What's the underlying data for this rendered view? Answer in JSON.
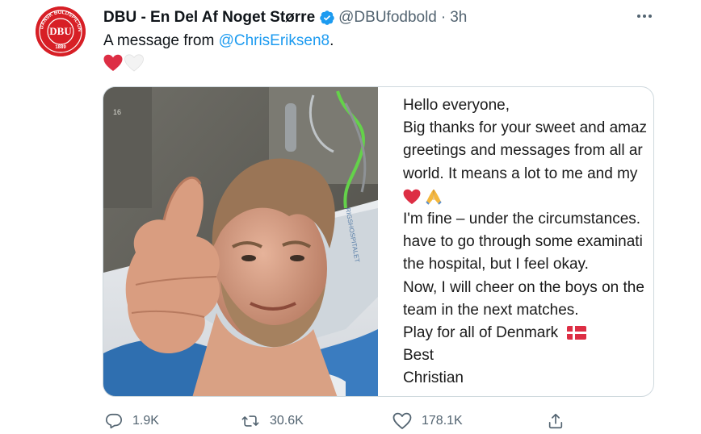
{
  "tweet": {
    "display_name": "DBU - En Del Af Noget Større",
    "handle": "@DBUfodbold",
    "separator": "·",
    "time": "3h",
    "text_prefix": "A message from ",
    "mention": "@ChrisEriksen8",
    "text_suffix": ".",
    "emojis": [
      "red-heart",
      "white-heart"
    ]
  },
  "avatar": {
    "logo_text": "DBU",
    "ring_text": "DANSK BOLDSPIL-UNION",
    "year": "1889"
  },
  "photo": {
    "wall_label": "16",
    "pillow_text": "RIGSHOSPITALET"
  },
  "letter": {
    "lines": [
      "Hello everyone,",
      "Big thanks for your sweet and amaz",
      "greetings and messages from all ar",
      "world. It means a lot to me and my",
      "",
      "I'm fine – under the circumstances.",
      "have to go through some examinati",
      "the hospital, but I feel okay.",
      "Now, I will cheer on the boys on the",
      "team in the next matches.",
      "Play for all of Denmark",
      "Best",
      "Christian"
    ],
    "emoji_line_icons": [
      "red-heart",
      "folded-hands"
    ],
    "flag_icon": "denmark-flag"
  },
  "actions": {
    "reply_count": "1.9K",
    "retweet_count": "30.6K",
    "like_count": "178.1K"
  },
  "colors": {
    "link": "#1d9bf0",
    "secondary_text": "#536471",
    "verified": "#1d9bf0",
    "brand_red": "#d71f26"
  }
}
